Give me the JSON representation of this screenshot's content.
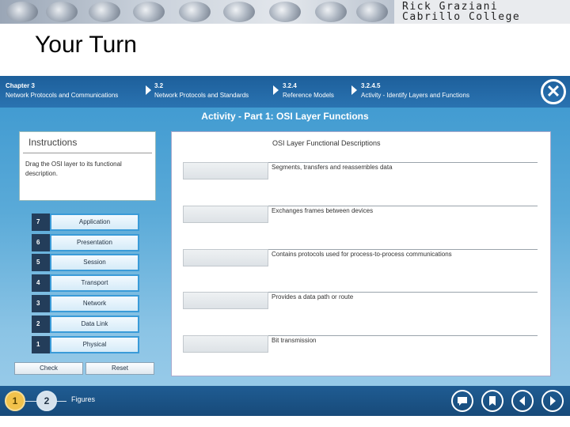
{
  "banner": {
    "author_name": "Rick Graziani",
    "author_org": "Cabrillo College"
  },
  "slide_title": "Your Turn",
  "nav": {
    "crumbs": [
      {
        "title": "Chapter 3",
        "subtitle": "Network Protocols and Communications"
      },
      {
        "title": "3.2",
        "subtitle": "Network Protocols and Standards"
      },
      {
        "title": "3.2.4",
        "subtitle": "Reference Models"
      },
      {
        "title": "3.2.4.5",
        "subtitle": "Activity - Identify Layers and Functions"
      }
    ],
    "close_icon": "close-icon"
  },
  "activity_title": "Activity - Part 1: OSI Layer Functions",
  "instructions": {
    "heading": "Instructions",
    "body": "Drag the OSI layer to its functional description."
  },
  "layers": [
    {
      "number": "7",
      "name": "Application"
    },
    {
      "number": "6",
      "name": "Presentation"
    },
    {
      "number": "5",
      "name": "Session"
    },
    {
      "number": "4",
      "name": "Transport"
    },
    {
      "number": "3",
      "name": "Network"
    },
    {
      "number": "2",
      "name": "Data Link"
    },
    {
      "number": "1",
      "name": "Physical"
    }
  ],
  "controls": {
    "check_label": "Check",
    "reset_label": "Reset"
  },
  "descriptions": {
    "heading": "OSI Layer Functional Descriptions",
    "items": [
      "Segments, transfers and reassembles data",
      "Exchanges frames between devices",
      "Contains protocols used for process-to-process communications",
      "Provides a data path or route",
      "Bit transmission"
    ]
  },
  "bottom": {
    "pages": [
      "1",
      "2"
    ],
    "active_page": "1",
    "figures_label": "Figures",
    "icons": [
      "comment-icon",
      "bookmark-icon",
      "previous-icon",
      "next-icon"
    ]
  },
  "colors": {
    "nav_bar": "#1d5f9b",
    "content_bg": "#5aaad8",
    "active_page": "#f2c24b"
  }
}
